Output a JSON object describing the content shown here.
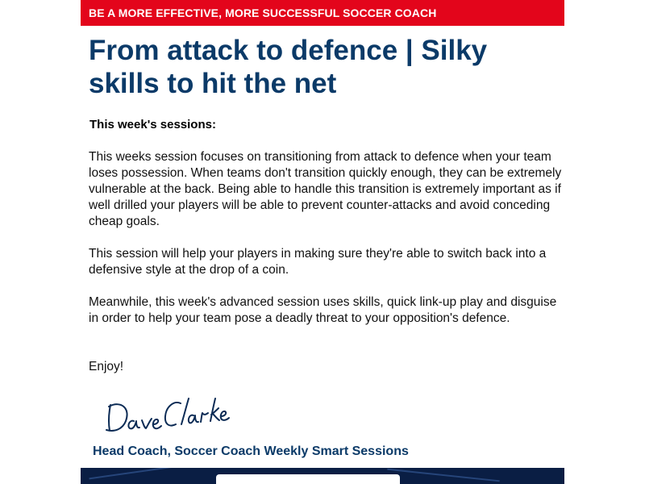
{
  "banner": {
    "text": "BE A MORE EFFECTIVE, MORE SUCCESSFUL SOCCER COACH",
    "color": "#e3051b"
  },
  "article": {
    "title": "From attack to defence | Silky skills to hit the net",
    "subheading": "This week's sessions:",
    "paragraphs": [
      "This weeks session focuses on transitioning from attack to defence when your team loses possession. When teams don't transition quickly enough, they can be extremely vulnerable at the back. Being able to handle this transition is extremely important as if well drilled your players will be able to prevent counter-attacks and avoid conceding cheap goals.",
      "This session will help your players in making sure they're able to switch back into a defensive style at the drop of a coin.",
      "Meanwhile, this week's advanced session uses skills, quick link-up play and disguise in order to help your team pose a deadly threat to your opposition's defence.",
      "Enjoy!"
    ],
    "signature": "Dave Clarke",
    "credit": "Head Coach, Soccer Coach Weekly Smart Sessions"
  },
  "colors": {
    "title": "#0b3a68",
    "footer": "#0a1e44"
  }
}
